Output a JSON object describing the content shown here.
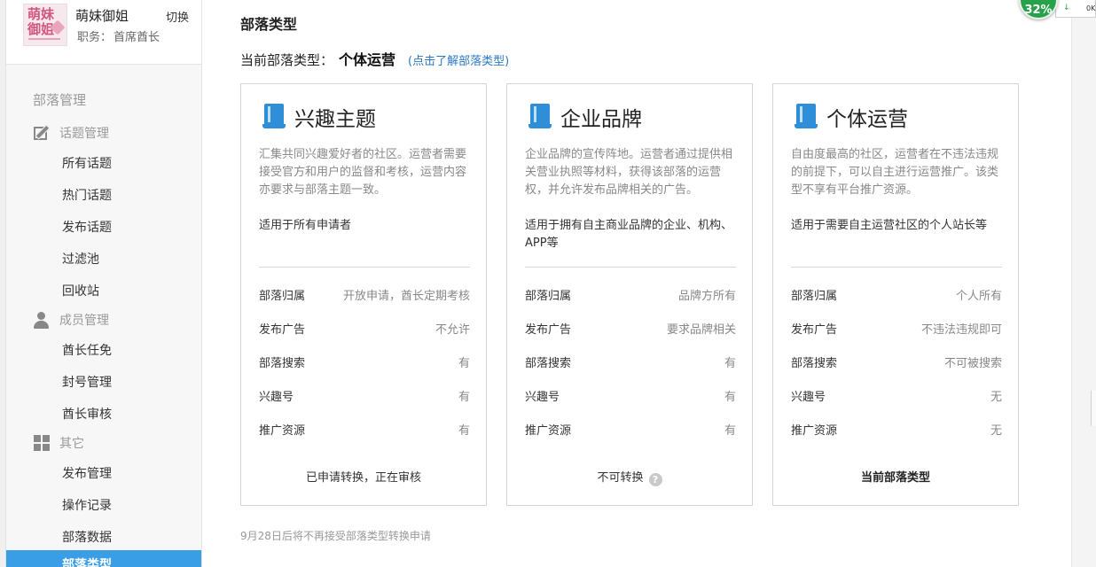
{
  "user": {
    "name": "萌妹御姐",
    "switch_label": "切换",
    "role_label": "职务：",
    "role_value": "首席酋长",
    "avatar_text": "萌妹\n御姐"
  },
  "sidebar": {
    "title": "部落管理",
    "groups": [
      {
        "label": "话题管理",
        "icon": "edit-icon",
        "items": [
          "所有话题",
          "热门话题",
          "发布话题",
          "过滤池",
          "回收站"
        ]
      },
      {
        "label": "成员管理",
        "icon": "person-icon",
        "items": [
          "酋长任免",
          "封号管理",
          "酋长审核"
        ]
      },
      {
        "label": "其它",
        "icon": "grid-icon",
        "items": [
          "发布管理",
          "操作记录",
          "部落数据",
          "部落类型"
        ]
      }
    ],
    "active_item": "部落类型"
  },
  "main": {
    "title": "部落类型",
    "current_label": "当前部落类型：",
    "current_value": "个体运营",
    "learn_link": "(点击了解部落类型)",
    "notice": "9月28日后将不再接受部落类型转换申请"
  },
  "cards": [
    {
      "title": "兴趣主题",
      "icon": "book-icon",
      "desc": "汇集共同兴趣爱好者的社区。运营者需要接受官方和用户的监督和考核，运营内容亦要求与部落主题一致。",
      "applies": "适用于所有申请者",
      "rows": [
        {
          "k": "部落归属",
          "v": "开放申请，酋长定期考核"
        },
        {
          "k": "发布广告",
          "v": "不允许"
        },
        {
          "k": "部落搜索",
          "v": "有"
        },
        {
          "k": "兴趣号",
          "v": "有"
        },
        {
          "k": "推广资源",
          "v": "有"
        }
      ],
      "footer": "已申请转换，正在审核"
    },
    {
      "title": "企业品牌",
      "icon": "book-icon",
      "desc": "企业品牌的宣传阵地。运营者通过提供相关营业执照等材料，获得该部落的运营权，并允许发布品牌相关的广告。",
      "applies": "适用于拥有自主商业品牌的企业、机构、APP等",
      "rows": [
        {
          "k": "部落归属",
          "v": "品牌方所有"
        },
        {
          "k": "发布广告",
          "v": "要求品牌相关"
        },
        {
          "k": "部落搜索",
          "v": "有"
        },
        {
          "k": "兴趣号",
          "v": "有"
        },
        {
          "k": "推广资源",
          "v": "有"
        }
      ],
      "footer": "不可转换",
      "footer_icon": "?"
    },
    {
      "title": "个体运营",
      "icon": "book-icon",
      "desc": "自由度最高的社区，运营者在不违法违规的前提下，可以自主进行运营推广。该类型不享有平台推广资源。",
      "applies": "适用于需要自主运营社区的个人站长等",
      "rows": [
        {
          "k": "部落归属",
          "v": "个人所有"
        },
        {
          "k": "发布广告",
          "v": "不违法违规即可"
        },
        {
          "k": "部落搜索",
          "v": "不可被搜索"
        },
        {
          "k": "兴趣号",
          "v": "无"
        },
        {
          "k": "推广资源",
          "v": "无"
        }
      ],
      "footer": "当前部落类型"
    }
  ],
  "overlay": {
    "speed_percent": "32%",
    "speed_status": "0K",
    "speed_arrow": "↓"
  },
  "colors": {
    "accent": "#3a9ee6",
    "book_icon": "#2e8fd8",
    "link": "#2b78c5",
    "speed_badge": "#27a14a"
  }
}
